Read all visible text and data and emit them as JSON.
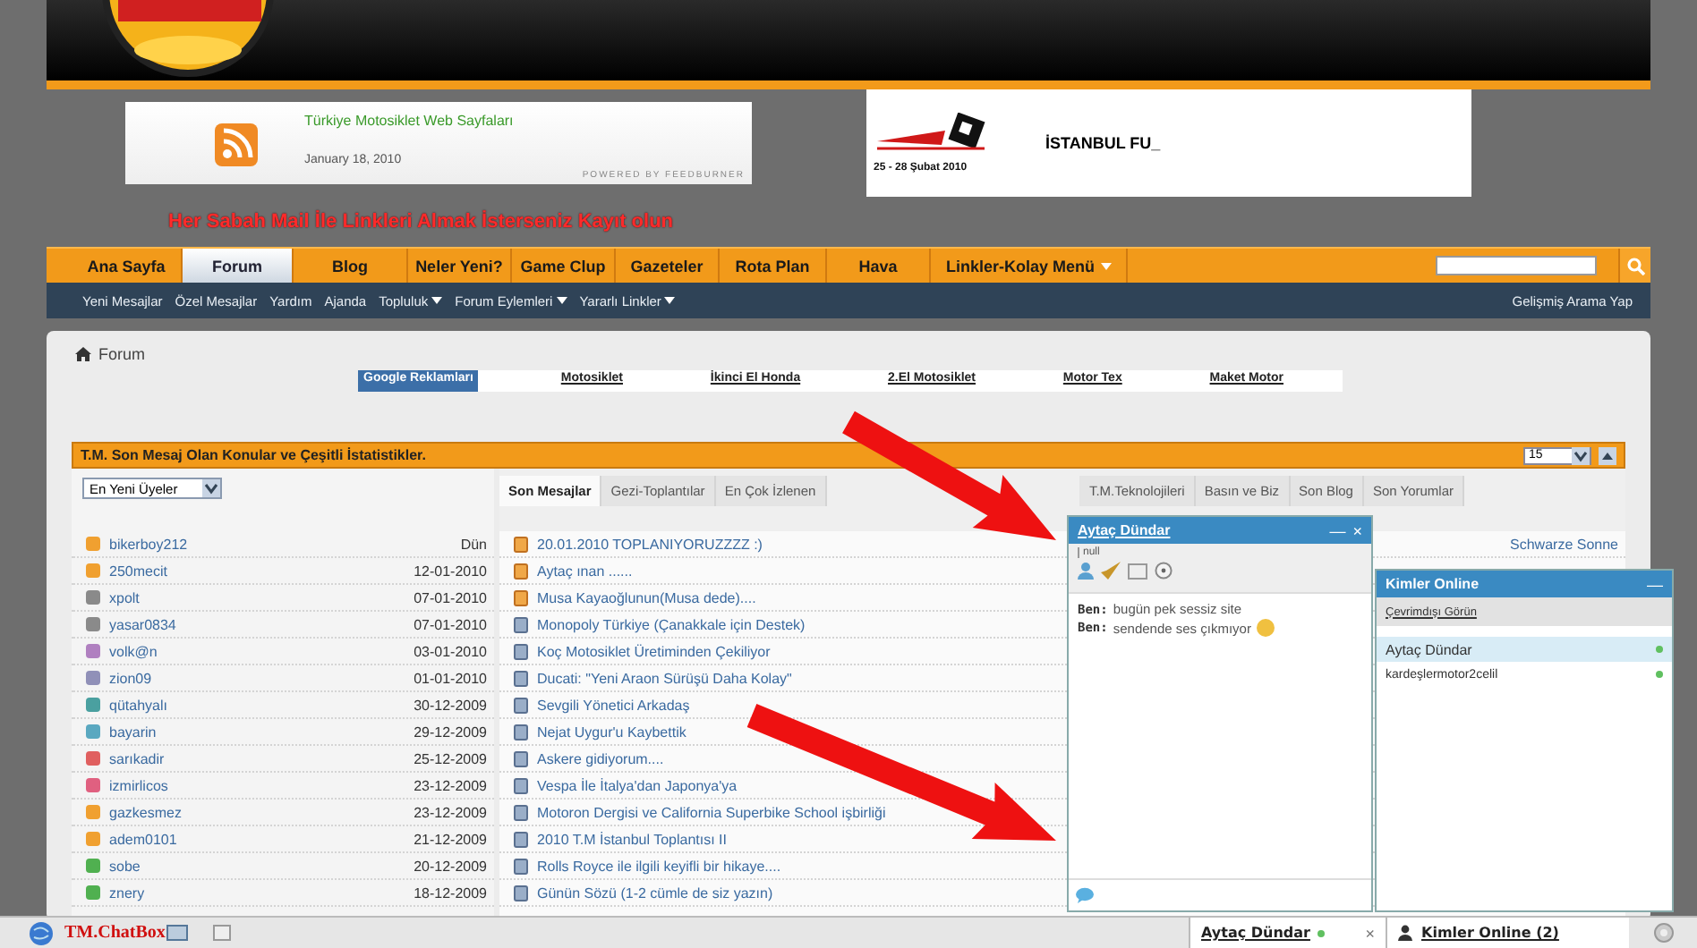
{
  "feed": {
    "title": "Türkiye Motosiklet Web Sayfaları",
    "date": "January 18, 2010",
    "powered": "POWERED BY FEEDBURNER"
  },
  "event": {
    "dates": "25 - 28 Şubat 2010",
    "title": "İSTANBUL FU_"
  },
  "notice": "Her Sabah Mail İle Linkleri Almak İsterseniz Kayıt olun",
  "nav": {
    "items": [
      {
        "label": "Ana Sayfa",
        "selected": false,
        "dropdown": false
      },
      {
        "label": "Forum",
        "selected": true,
        "dropdown": false
      },
      {
        "label": "Blog",
        "selected": false,
        "dropdown": false
      },
      {
        "label": "Neler Yeni?",
        "selected": false,
        "dropdown": false
      },
      {
        "label": "Game Clup",
        "selected": false,
        "dropdown": false
      },
      {
        "label": "Gazeteler",
        "selected": false,
        "dropdown": false
      },
      {
        "label": "Rota Plan",
        "selected": false,
        "dropdown": false
      },
      {
        "label": "Hava",
        "selected": false,
        "dropdown": false
      },
      {
        "label": "Linkler-Kolay Menü",
        "selected": false,
        "dropdown": true
      }
    ]
  },
  "subnav": {
    "items": [
      {
        "label": "Yeni Mesajlar",
        "dropdown": false
      },
      {
        "label": "Özel Mesajlar",
        "dropdown": false
      },
      {
        "label": "Yardım",
        "dropdown": false
      },
      {
        "label": "Ajanda",
        "dropdown": false
      },
      {
        "label": "Topluluk",
        "dropdown": true
      },
      {
        "label": "Forum Eylemleri",
        "dropdown": true
      },
      {
        "label": "Yararlı Linkler",
        "dropdown": true
      }
    ],
    "advanced_search": "Gelişmiş Arama Yap"
  },
  "breadcrumb": "Forum",
  "ad_links": [
    {
      "label": "Google Reklamları",
      "kind": "heading"
    },
    {
      "label": "Motosiklet",
      "kind": "link"
    },
    {
      "label": "İkinci El Honda",
      "kind": "link"
    },
    {
      "label": "2.El Motosiklet",
      "kind": "link"
    },
    {
      "label": "Motor Tex",
      "kind": "link"
    },
    {
      "label": "Maket Motor",
      "kind": "link"
    }
  ],
  "stats": {
    "title": "T.M. Son Mesaj Olan Konular ve Çeşitli İstatistikler.",
    "per_page": "15",
    "member_filter": "En Yeni Üyeler",
    "members": [
      {
        "name": "bikerboy212",
        "date": "Dün",
        "color": "#f0a030"
      },
      {
        "name": "250mecit",
        "date": "12-01-2010",
        "color": "#f0a030"
      },
      {
        "name": "xpolt",
        "date": "07-01-2010",
        "color": "#8a8a8a"
      },
      {
        "name": "yasar0834",
        "date": "07-01-2010",
        "color": "#8a8a8a"
      },
      {
        "name": "volk@n",
        "date": "03-01-2010",
        "color": "#b080c0"
      },
      {
        "name": "zion09",
        "date": "01-01-2010",
        "color": "#9090b8"
      },
      {
        "name": "qütahyalı",
        "date": "30-12-2009",
        "color": "#4aa0a0"
      },
      {
        "name": "bayarin",
        "date": "29-12-2009",
        "color": "#5aa8c0"
      },
      {
        "name": "sarıkadir",
        "date": "25-12-2009",
        "color": "#e06060"
      },
      {
        "name": "izmirlicos",
        "date": "23-12-2009",
        "color": "#e06080"
      },
      {
        "name": "gazkesmez",
        "date": "23-12-2009",
        "color": "#f0a030"
      },
      {
        "name": "adem0101",
        "date": "21-12-2009",
        "color": "#f0a030"
      },
      {
        "name": "sobe",
        "date": "20-12-2009",
        "color": "#50b050"
      },
      {
        "name": "znery",
        "date": "18-12-2009",
        "color": "#50b050"
      }
    ],
    "tabs": [
      {
        "label": "Son Mesajlar",
        "selected": true
      },
      {
        "label": "Gezi-Toplantılar",
        "selected": false
      },
      {
        "label": "En Çok İzlenen",
        "selected": false
      },
      {
        "label": "T.M.Teknolojileri",
        "selected": false
      },
      {
        "label": "Basın ve Biz",
        "selected": false
      },
      {
        "label": "Son Blog",
        "selected": false
      },
      {
        "label": "Son Yorumlar",
        "selected": false
      }
    ],
    "topics": [
      {
        "title": "20.01.2010 TOPLANIYORUZZZZ :)",
        "hot": true,
        "poster": "Schwarze Sonne"
      },
      {
        "title": "Aytaç ınan ......",
        "hot": true
      },
      {
        "title": "Musa Kayaoğlunun(Musa dede)....",
        "hot": true
      },
      {
        "title": "Monopoly Türkiye (Çanakkale için Destek)",
        "hot": false
      },
      {
        "title": "Koç Motosiklet Üretiminden Çekiliyor",
        "hot": false
      },
      {
        "title": "Ducati: \"Yeni Araon Sürüşü Daha Kolay\"",
        "hot": false
      },
      {
        "title": "Sevgili Yönetici Arkadaş",
        "hot": false
      },
      {
        "title": "Nejat Uygur'u Kaybettik",
        "hot": false
      },
      {
        "title": "Askere gidiyorum....",
        "hot": false
      },
      {
        "title": "Vespa İle İtalya'dan Japonya'ya",
        "hot": false
      },
      {
        "title": "Motoron Dergisi ve California Superbike School işbirliği",
        "hot": false
      },
      {
        "title": "2010 T.M İstanbul Toplantısı II",
        "hot": false
      },
      {
        "title": "Rolls Royce ile ilgili keyifli bir hikaye....",
        "hot": false
      },
      {
        "title": "Günün Sözü (1-2 cümle de siz yazın)",
        "hot": false
      }
    ]
  },
  "chat": {
    "title": "Aytaç Dündar",
    "window_controls": [
      "—",
      "×"
    ],
    "status": "null",
    "messages": [
      {
        "sender": "Ben:",
        "text": "bugün pek sessiz site",
        "emoticon": false
      },
      {
        "sender": "Ben:",
        "text": "sendende ses çıkmıyor",
        "emoticon": true
      }
    ]
  },
  "online": {
    "title": "Kimler Online",
    "window_controls": [
      "—"
    ],
    "invisible_link": "Çevrimdışı Görün",
    "users": [
      {
        "name": "Aytaç Dündar",
        "selected": true,
        "online": true
      },
      {
        "name": "kardeşlermotor2celil",
        "selected": false,
        "online": true
      }
    ]
  },
  "taskbar": {
    "brand": "TM.ChatBox",
    "chats": [
      {
        "label": "Aytaç Dündar",
        "online": true,
        "close": "×"
      }
    ],
    "online_tab": "Kimler Online (2)"
  }
}
